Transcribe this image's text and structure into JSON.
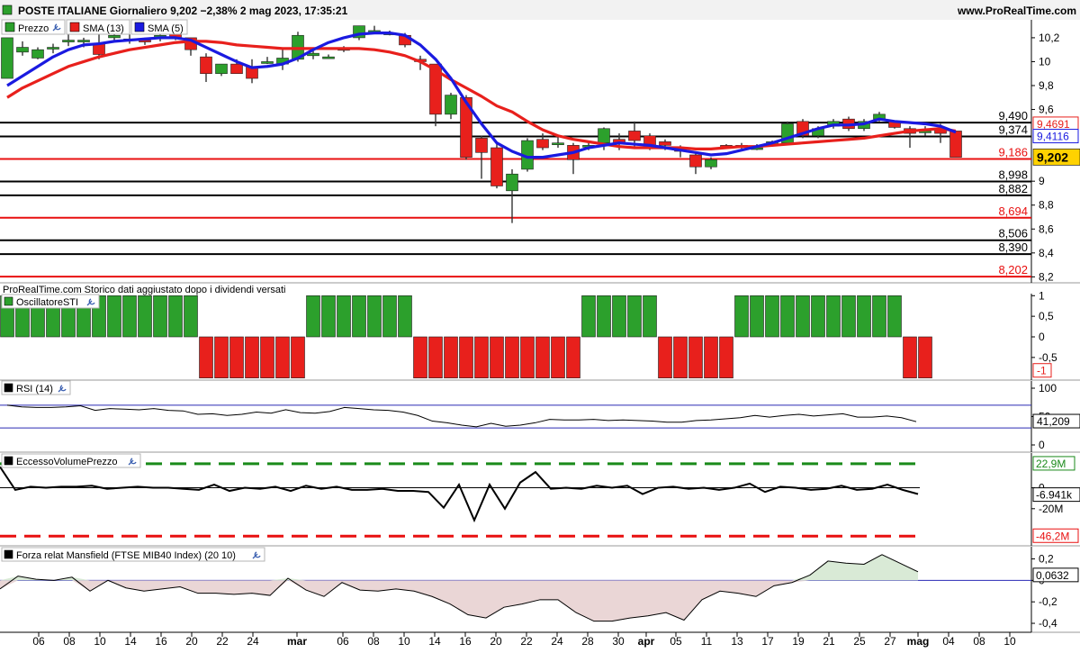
{
  "header": {
    "title": "POSTE ITALIANE Giornaliero 9,202 −2,38% 2 mag 2023, 17:35:21",
    "site": "www.ProRealTime.com"
  },
  "colors": {
    "up": "#2ca02c",
    "down": "#e8201c",
    "sma13": "#e8201c",
    "sma5": "#1a1ae0",
    "axis": "#000000",
    "hline_red": "#e81010",
    "greenDash": "#1a8a1a",
    "redDash": "#e81010"
  },
  "chart_data": [
    {
      "panel": "price",
      "type": "candlestick",
      "legend": [
        {
          "label": "Prezzo",
          "color": "#2ca02c"
        },
        {
          "label": "SMA (13)",
          "color": "#e8201c"
        },
        {
          "label": "SMA (5)",
          "color": "#1a1ae0"
        }
      ],
      "x_ticks": [
        "06",
        "08",
        "10",
        "14",
        "16",
        "20",
        "22",
        "24",
        "mar",
        "06",
        "08",
        "10",
        "14",
        "16",
        "20",
        "22",
        "24",
        "28",
        "30",
        "apr",
        "05",
        "11",
        "13",
        "17",
        "19",
        "21",
        "25",
        "27",
        "mag",
        "04",
        "08",
        "10"
      ],
      "ylim": [
        8.15,
        10.35
      ],
      "y_ticks": [
        "10,2",
        "10",
        "9,8",
        "9,6",
        "9",
        "8,8",
        "8,6",
        "8,4",
        "8,2"
      ],
      "candles": [
        {
          "o": 9.86,
          "h": 10.2,
          "l": 9.86,
          "c": 10.2
        },
        {
          "o": 10.08,
          "h": 10.17,
          "l": 10.05,
          "c": 10.12
        },
        {
          "o": 10.03,
          "h": 10.12,
          "l": 10.02,
          "c": 10.1
        },
        {
          "o": 10.12,
          "h": 10.15,
          "l": 10.07,
          "c": 10.12
        },
        {
          "o": 10.17,
          "h": 10.27,
          "l": 10.13,
          "c": 10.18
        },
        {
          "o": 10.17,
          "h": 10.2,
          "l": 10.12,
          "c": 10.18
        },
        {
          "o": 10.15,
          "h": 10.24,
          "l": 10.02,
          "c": 10.06
        },
        {
          "o": 10.2,
          "h": 10.27,
          "l": 10.18,
          "c": 10.22
        },
        {
          "o": 10.19,
          "h": 10.23,
          "l": 10.15,
          "c": 10.18
        },
        {
          "o": 10.18,
          "h": 10.2,
          "l": 10.14,
          "c": 10.17
        },
        {
          "o": 10.2,
          "h": 10.23,
          "l": 10.17,
          "c": 10.22
        },
        {
          "o": 10.24,
          "h": 10.25,
          "l": 10.18,
          "c": 10.2
        },
        {
          "o": 10.2,
          "h": 10.2,
          "l": 10.05,
          "c": 10.1
        },
        {
          "o": 10.04,
          "h": 10.07,
          "l": 9.83,
          "c": 9.9
        },
        {
          "o": 9.9,
          "h": 9.98,
          "l": 9.88,
          "c": 9.98
        },
        {
          "o": 9.98,
          "h": 10.02,
          "l": 9.9,
          "c": 9.9
        },
        {
          "o": 9.96,
          "h": 10.02,
          "l": 9.82,
          "c": 9.86
        },
        {
          "o": 10.0,
          "h": 10.04,
          "l": 9.98,
          "c": 10.0
        },
        {
          "o": 9.98,
          "h": 10.12,
          "l": 9.93,
          "c": 10.03
        },
        {
          "o": 10.02,
          "h": 10.25,
          "l": 10.0,
          "c": 10.22
        },
        {
          "o": 10.05,
          "h": 10.09,
          "l": 10.02,
          "c": 10.07
        },
        {
          "o": 10.04,
          "h": 10.06,
          "l": 10.03,
          "c": 10.04
        },
        {
          "o": 10.1,
          "h": 10.13,
          "l": 10.08,
          "c": 10.11
        },
        {
          "o": 10.2,
          "h": 10.3,
          "l": 10.18,
          "c": 10.3
        },
        {
          "o": 10.26,
          "h": 10.3,
          "l": 10.24,
          "c": 10.26
        },
        {
          "o": 10.24,
          "h": 10.26,
          "l": 10.22,
          "c": 10.24
        },
        {
          "o": 10.22,
          "h": 10.24,
          "l": 10.12,
          "c": 10.14
        },
        {
          "o": 10.02,
          "h": 10.05,
          "l": 9.93,
          "c": 10.0
        },
        {
          "o": 9.98,
          "h": 9.98,
          "l": 9.46,
          "c": 9.56
        },
        {
          "o": 9.56,
          "h": 9.74,
          "l": 9.52,
          "c": 9.72
        },
        {
          "o": 9.7,
          "h": 9.72,
          "l": 9.18,
          "c": 9.2
        },
        {
          "o": 9.36,
          "h": 9.38,
          "l": 9.02,
          "c": 9.24
        },
        {
          "o": 9.28,
          "h": 9.33,
          "l": 8.94,
          "c": 8.96
        },
        {
          "o": 8.92,
          "h": 9.1,
          "l": 8.65,
          "c": 9.06
        },
        {
          "o": 9.1,
          "h": 9.36,
          "l": 9.08,
          "c": 9.34
        },
        {
          "o": 9.35,
          "h": 9.4,
          "l": 9.26,
          "c": 9.28
        },
        {
          "o": 9.32,
          "h": 9.37,
          "l": 9.28,
          "c": 9.32
        },
        {
          "o": 9.3,
          "h": 9.32,
          "l": 9.06,
          "c": 9.18
        },
        {
          "o": 9.3,
          "h": 9.34,
          "l": 9.26,
          "c": 9.3
        },
        {
          "o": 9.32,
          "h": 9.45,
          "l": 9.26,
          "c": 9.44
        },
        {
          "o": 9.35,
          "h": 9.4,
          "l": 9.26,
          "c": 9.32
        },
        {
          "o": 9.42,
          "h": 9.5,
          "l": 9.28,
          "c": 9.34
        },
        {
          "o": 9.38,
          "h": 9.4,
          "l": 9.26,
          "c": 9.28
        },
        {
          "o": 9.33,
          "h": 9.35,
          "l": 9.26,
          "c": 9.3
        },
        {
          "o": 9.28,
          "h": 9.3,
          "l": 9.2,
          "c": 9.25
        },
        {
          "o": 9.22,
          "h": 9.24,
          "l": 9.06,
          "c": 9.12
        },
        {
          "o": 9.12,
          "h": 9.2,
          "l": 9.1,
          "c": 9.18
        },
        {
          "o": 9.3,
          "h": 9.31,
          "l": 9.28,
          "c": 9.29
        },
        {
          "o": 9.29,
          "h": 9.32,
          "l": 9.27,
          "c": 9.3
        },
        {
          "o": 9.28,
          "h": 9.31,
          "l": 9.26,
          "c": 9.28
        },
        {
          "o": 9.3,
          "h": 9.34,
          "l": 9.29,
          "c": 9.33
        },
        {
          "o": 9.32,
          "h": 9.5,
          "l": 9.3,
          "c": 9.48
        },
        {
          "o": 9.5,
          "h": 9.52,
          "l": 9.36,
          "c": 9.38
        },
        {
          "o": 9.38,
          "h": 9.46,
          "l": 9.36,
          "c": 9.44
        },
        {
          "o": 9.46,
          "h": 9.52,
          "l": 9.44,
          "c": 9.5
        },
        {
          "o": 9.52,
          "h": 9.54,
          "l": 9.42,
          "c": 9.44
        },
        {
          "o": 9.44,
          "h": 9.52,
          "l": 9.42,
          "c": 9.5
        },
        {
          "o": 9.52,
          "h": 9.58,
          "l": 9.5,
          "c": 9.56
        },
        {
          "o": 9.5,
          "h": 9.51,
          "l": 9.44,
          "c": 9.45
        },
        {
          "o": 9.44,
          "h": 9.46,
          "l": 9.28,
          "c": 9.4
        },
        {
          "o": 9.42,
          "h": 9.46,
          "l": 9.38,
          "c": 9.42
        },
        {
          "o": 9.44,
          "h": 9.48,
          "l": 9.32,
          "c": 9.4
        },
        {
          "o": 9.42,
          "h": 9.42,
          "l": 9.2,
          "c": 9.2
        }
      ],
      "sma13": [
        9.7,
        9.78,
        9.84,
        9.9,
        9.96,
        10.0,
        10.04,
        10.07,
        10.1,
        10.12,
        10.14,
        10.16,
        10.17,
        10.17,
        10.16,
        10.14,
        10.13,
        10.12,
        10.11,
        10.11,
        10.11,
        10.11,
        10.11,
        10.11,
        10.1,
        10.08,
        10.05,
        10.0,
        9.93,
        9.85,
        9.78,
        9.71,
        9.63,
        9.58,
        9.5,
        9.43,
        9.38,
        9.35,
        9.33,
        9.31,
        9.29,
        9.28,
        9.28,
        9.28,
        9.28,
        9.27,
        9.27,
        9.28,
        9.29,
        9.29,
        9.3,
        9.31,
        9.32,
        9.33,
        9.34,
        9.35,
        9.36,
        9.38,
        9.4,
        9.42,
        9.43,
        9.44,
        9.42
      ],
      "sma5": [
        9.8,
        9.88,
        9.96,
        10.04,
        10.1,
        10.14,
        10.15,
        10.17,
        10.18,
        10.19,
        10.2,
        10.2,
        10.18,
        10.12,
        10.06,
        10.0,
        9.95,
        9.96,
        9.98,
        10.03,
        10.1,
        10.16,
        10.2,
        10.23,
        10.24,
        10.24,
        10.22,
        10.14,
        10.02,
        9.86,
        9.66,
        9.48,
        9.32,
        9.25,
        9.2,
        9.2,
        9.22,
        9.24,
        9.28,
        9.3,
        9.32,
        9.31,
        9.3,
        9.28,
        9.26,
        9.24,
        9.22,
        9.23,
        9.26,
        9.29,
        9.32,
        9.36,
        9.4,
        9.44,
        9.47,
        9.47,
        9.48,
        9.52,
        9.5,
        9.49,
        9.48,
        9.46,
        9.41
      ],
      "hlines": [
        {
          "value": 9.49,
          "label": "9,490",
          "color": "#000000"
        },
        {
          "value": 9.374,
          "label": "9,374",
          "color": "#000000"
        },
        {
          "value": 9.186,
          "label": "9,186",
          "color": "#e81010"
        },
        {
          "value": 8.998,
          "label": "8,998",
          "color": "#000000"
        },
        {
          "value": 8.882,
          "label": "8,882",
          "color": "#000000"
        },
        {
          "value": 8.694,
          "label": "8,694",
          "color": "#e81010"
        },
        {
          "value": 8.506,
          "label": "8,506",
          "color": "#000000"
        },
        {
          "value": 8.39,
          "label": "8,390",
          "color": "#000000"
        },
        {
          "value": 8.202,
          "label": "8,202",
          "color": "#e81010"
        }
      ],
      "markers": [
        {
          "value": 9.4691,
          "label": "9,4691",
          "color": "#e8201c",
          "bold": false
        },
        {
          "value": 9.4116,
          "label": "9,4116",
          "color": "#1a1ae0",
          "bold": false
        },
        {
          "value": 9.202,
          "label": "9,202",
          "color": "#000000",
          "bold": true
        }
      ],
      "footnote": "ProRealTime.com Storico dati aggiustato dopo i dividendi versati"
    },
    {
      "panel": "sti",
      "type": "bar",
      "title": "OscillatoreSTI",
      "ylim": [
        -1.05,
        1.05
      ],
      "y_ticks": [
        "1",
        "0,5",
        "0",
        "-0,5"
      ],
      "last_label": "-1",
      "bars": [
        {
          "start": 0,
          "end": 12,
          "value": 1
        },
        {
          "start": 13,
          "end": 19,
          "value": -1
        },
        {
          "start": 20,
          "end": 26,
          "value": 1
        },
        {
          "start": 27,
          "end": 37,
          "value": -1
        },
        {
          "start": 38,
          "end": 42,
          "value": 1
        },
        {
          "start": 43,
          "end": 47,
          "value": -1
        },
        {
          "start": 48,
          "end": 58,
          "value": 1
        },
        {
          "start": 59,
          "end": 60,
          "value": -1
        }
      ]
    },
    {
      "panel": "rsi",
      "type": "line",
      "title": "RSI (14)",
      "ylim": [
        0,
        100
      ],
      "y_ticks": [
        "100",
        "50",
        "0"
      ],
      "bands": [
        70,
        30
      ],
      "last_label": "41,209",
      "values": [
        70,
        67,
        66,
        66,
        67,
        69,
        61,
        64,
        63,
        62,
        64,
        61,
        60,
        54,
        55,
        52,
        54,
        58,
        56,
        62,
        57,
        56,
        59,
        66,
        64,
        62,
        61,
        58,
        52,
        42,
        39,
        35,
        32,
        38,
        33,
        35,
        39,
        45,
        44,
        44,
        45,
        43,
        44,
        43,
        42,
        40,
        40,
        43,
        44,
        46,
        48,
        52,
        49,
        52,
        54,
        51,
        53,
        55,
        49,
        49,
        51,
        48,
        41
      ]
    },
    {
      "panel": "evp",
      "type": "line",
      "title": "EccessoVolumePrezzo",
      "ylim": [
        -52,
        28
      ],
      "y_ticks": [
        "0",
        "-20M"
      ],
      "dash_top": {
        "value": 22.9,
        "label": "22,9M"
      },
      "dash_bottom": {
        "value": -46.2,
        "label": "-46,2M"
      },
      "last_label": "-6.941k",
      "values": [
        20,
        -2,
        1,
        0,
        1,
        1,
        2,
        -1,
        0,
        1,
        0,
        0,
        -1,
        -2,
        3,
        -3,
        0,
        -1,
        1,
        -3,
        2,
        -1,
        1,
        -2,
        -2,
        -1,
        -3,
        -3,
        -4,
        -19,
        3,
        -31,
        3,
        -20,
        5,
        15,
        -1,
        0,
        -1,
        2,
        0,
        2,
        -6,
        0,
        1,
        -1,
        0,
        -2,
        0,
        4,
        -4,
        1,
        0,
        -2,
        -1,
        2,
        -2,
        -1,
        3,
        -2,
        -6
      ]
    },
    {
      "panel": "mansfield",
      "type": "area",
      "title": "Forza relat Mansfield (FTSE MIB40 Index) (20 10)",
      "ylim": [
        -0.45,
        0.28
      ],
      "y_ticks": [
        "0,2",
        "0",
        "-0,2",
        "-0,4"
      ],
      "last_label": "0,0632",
      "values": [
        -0.08,
        0.04,
        0.01,
        0.0,
        0.03,
        -0.1,
        0.0,
        -0.07,
        -0.1,
        -0.08,
        -0.06,
        -0.12,
        -0.12,
        -0.13,
        -0.12,
        -0.14,
        0.02,
        -0.09,
        -0.15,
        -0.02,
        -0.09,
        -0.1,
        -0.08,
        -0.1,
        -0.15,
        -0.22,
        -0.32,
        -0.35,
        -0.25,
        -0.22,
        -0.18,
        -0.18,
        -0.3,
        -0.38,
        -0.38,
        -0.35,
        -0.33,
        -0.3,
        -0.37,
        -0.18,
        -0.1,
        -0.12,
        -0.15,
        -0.05,
        -0.02,
        0.05,
        0.18,
        0.16,
        0.15,
        0.24,
        0.16,
        0.08
      ]
    }
  ]
}
